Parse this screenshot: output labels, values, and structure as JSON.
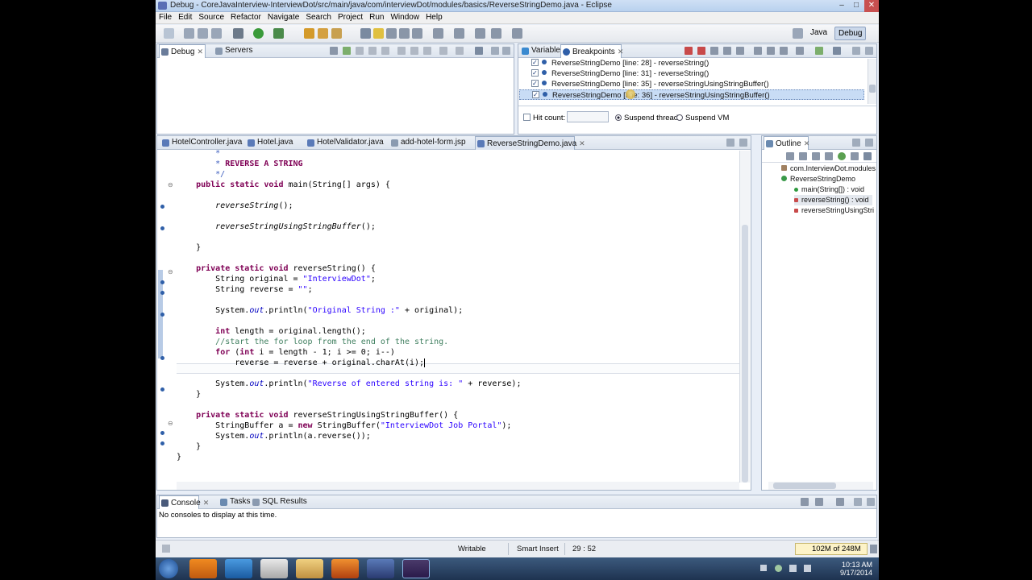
{
  "window": {
    "title": "Debug - CoreJavaInterview-InterviewDot/src/main/java/com/interviewDot/modules/basics/ReverseStringDemo.java - Eclipse",
    "minimize": "–",
    "maximize": "□",
    "close": "✕"
  },
  "menu": [
    "File",
    "Edit",
    "Source",
    "Refactor",
    "Navigate",
    "Search",
    "Project",
    "Run",
    "Window",
    "Help"
  ],
  "perspectives": {
    "java": "Java",
    "debug": "Debug"
  },
  "debug_panel": {
    "tabs": [
      {
        "label": "Debug"
      },
      {
        "label": "Servers"
      }
    ]
  },
  "breakpoints_panel": {
    "tabs": [
      {
        "label": "Variables"
      },
      {
        "label": "Breakpoints"
      }
    ],
    "rows": [
      {
        "text": "ReverseStringDemo [line: 28] - reverseString()"
      },
      {
        "text": "ReverseStringDemo [line: 31] - reverseString()"
      },
      {
        "text": "ReverseStringDemo [line: 35] - reverseStringUsingStringBuffer()"
      },
      {
        "text": "ReverseStringDemo [line: 36] - reverseStringUsingStringBuffer()"
      }
    ],
    "hit_count_label": "Hit count:",
    "hit_count_value": "",
    "suspend_thread": "Suspend thread",
    "suspend_vm": "Suspend VM"
  },
  "editor": {
    "tabs": [
      {
        "label": "HotelController.java"
      },
      {
        "label": "Hotel.java"
      },
      {
        "label": "HotelValidator.java"
      },
      {
        "label": "add-hotel-form.jsp"
      },
      {
        "label": "ReverseStringDemo.java"
      }
    ]
  },
  "outline": {
    "tab": "Outline",
    "items": [
      {
        "text": "com.InterviewDot.modules"
      },
      {
        "text": "ReverseStringDemo"
      },
      {
        "text": "main(String[]) : void"
      },
      {
        "text": "reverseString() : void"
      },
      {
        "text": "reverseStringUsingStri"
      }
    ]
  },
  "console": {
    "tabs": [
      {
        "label": "Console"
      },
      {
        "label": "Tasks"
      },
      {
        "label": "SQL Results"
      }
    ],
    "message": "No consoles to display at this time."
  },
  "status": {
    "writable": "Writable",
    "insert_mode": "Smart Insert",
    "position": "29 : 52",
    "memory": "102M of 248M"
  },
  "taskbar": {
    "time": "10:13 AM",
    "date": "9/17/2014"
  },
  "colors": {
    "keyword": "#7f0055",
    "string": "#2a00ff",
    "comment": "#3f7f5f",
    "selection": "#c8dcf5"
  }
}
